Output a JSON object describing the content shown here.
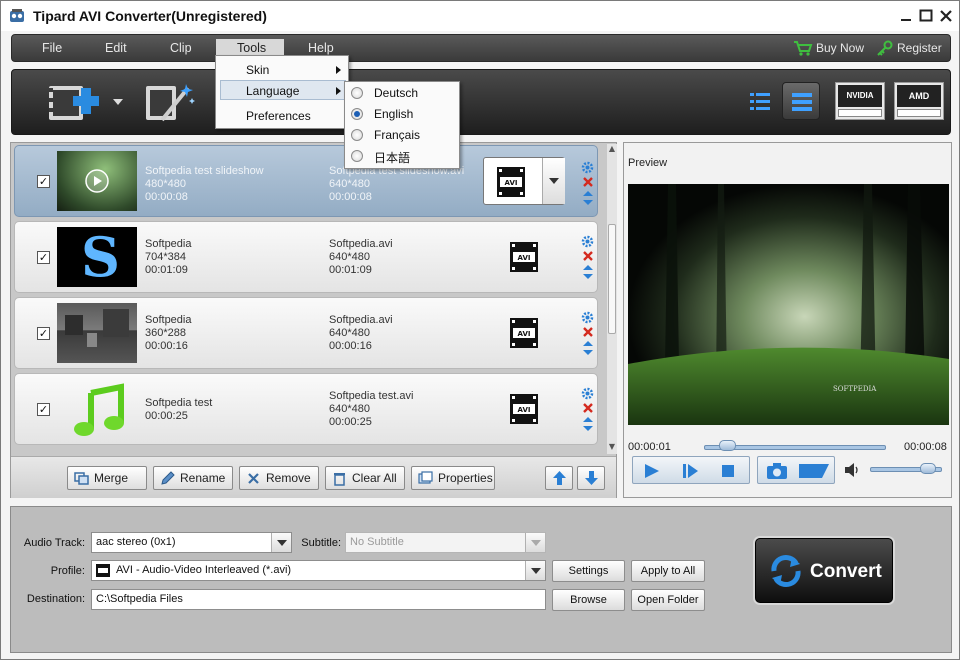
{
  "window": {
    "title": "Tipard AVI Converter(Unregistered)"
  },
  "menubar": {
    "items": [
      {
        "label": "File"
      },
      {
        "label": "Edit"
      },
      {
        "label": "Clip"
      },
      {
        "label": "Tools"
      },
      {
        "label": "Help"
      }
    ],
    "buy_now": "Buy Now",
    "register": "Register"
  },
  "tools_menu": {
    "items": [
      {
        "label": "Skin"
      },
      {
        "label": "Language"
      },
      {
        "label": "Preferences"
      }
    ]
  },
  "language_menu": {
    "options": [
      "Deutsch",
      "English",
      "Français",
      "日本語"
    ],
    "selected": "English"
  },
  "toolbar": {
    "gpu_badges": [
      "NVIDIA",
      "AMD"
    ]
  },
  "file_list": {
    "rows": [
      {
        "checked": true,
        "selected": true,
        "src_name": "Softpedia test slideshow",
        "src_res": "480*480",
        "src_dur": "00:00:08",
        "out_name": "Softpedia test slideshow.avi",
        "out_res": "640*480",
        "out_dur": "00:00:08"
      },
      {
        "checked": true,
        "selected": false,
        "src_name": "Softpedia",
        "src_res": "704*384",
        "src_dur": "00:01:09",
        "out_name": "Softpedia.avi",
        "out_res": "640*480",
        "out_dur": "00:01:09"
      },
      {
        "checked": true,
        "selected": false,
        "src_name": "Softpedia",
        "src_res": "360*288",
        "src_dur": "00:00:16",
        "out_name": "Softpedia.avi",
        "out_res": "640*480",
        "out_dur": "00:00:16"
      },
      {
        "checked": true,
        "selected": false,
        "src_name": "Softpedia test",
        "src_res": "",
        "src_dur": "00:00:25",
        "out_name": "Softpedia test.avi",
        "out_res": "640*480",
        "out_dur": "00:00:25"
      }
    ],
    "format_badge": "AVI"
  },
  "list_buttons": {
    "merge": "Merge",
    "rename": "Rename",
    "remove": "Remove",
    "clear_all": "Clear All",
    "properties": "Properties"
  },
  "preview": {
    "label": "Preview",
    "current_time": "00:00:01",
    "total_time": "00:00:08",
    "progress": 0.09,
    "volume": 0.9,
    "watermark": "SOFTPEDIA"
  },
  "settings": {
    "audio_track_label": "Audio Track:",
    "audio_track_value": "aac stereo (0x1)",
    "subtitle_label": "Subtitle:",
    "subtitle_value": "No Subtitle",
    "profile_label": "Profile:",
    "profile_value": "AVI - Audio-Video Interleaved (*.avi)",
    "destination_label": "Destination:",
    "destination_value": "C:\\Softpedia Files",
    "settings_btn": "Settings",
    "apply_all_btn": "Apply to All",
    "browse_btn": "Browse",
    "open_folder_btn": "Open Folder",
    "convert_btn": "Convert"
  },
  "colors": {
    "accent_blue": "#1e7fd9",
    "selected_row": "#9fb5cb",
    "delete_red": "#d42a1f"
  }
}
